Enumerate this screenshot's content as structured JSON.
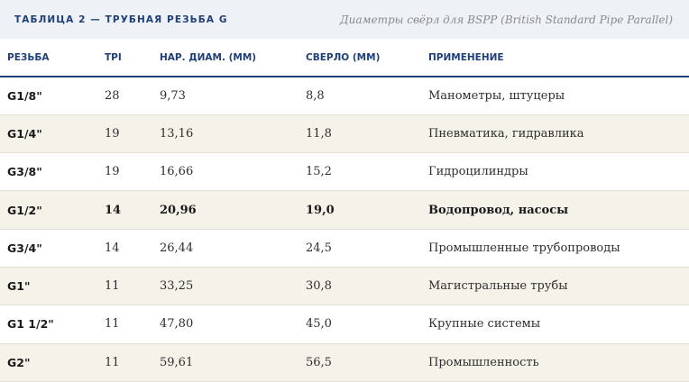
{
  "caption": {
    "title": "ТАБЛИЦА 2 — ТРУБНАЯ РЕЗЬБА G",
    "note": "Диаметры свёрл для BSPP (British Standard Pipe Parallel)"
  },
  "columns": [
    "РЕЗЬБА",
    "TPI",
    "НАР. ДИАМ. (ММ)",
    "СВЕРЛО (ММ)",
    "ПРИМЕНЕНИЕ"
  ],
  "rows": [
    {
      "thread": "G1/8\"",
      "tpi": "28",
      "od": "9,73",
      "drill": "8,8",
      "use": "Манометры, штуцеры"
    },
    {
      "thread": "G1/4\"",
      "tpi": "19",
      "od": "13,16",
      "drill": "11,8",
      "use": "Пневматика, гидравлика"
    },
    {
      "thread": "G3/8\"",
      "tpi": "19",
      "od": "16,66",
      "drill": "15,2",
      "use": "Гидроцилиндры"
    },
    {
      "thread": "G1/2\"",
      "tpi": "14",
      "od": "20,96",
      "drill": "19,0",
      "use": "Водопровод, насосы",
      "highlight": true
    },
    {
      "thread": "G3/4\"",
      "tpi": "14",
      "od": "26,44",
      "drill": "24,5",
      "use": "Промышленные трубопроводы"
    },
    {
      "thread": "G1\"",
      "tpi": "11",
      "od": "33,25",
      "drill": "30,8",
      "use": "Магистральные трубы"
    },
    {
      "thread": "G1 1/2\"",
      "tpi": "11",
      "od": "47,80",
      "drill": "45,0",
      "use": "Крупные системы"
    },
    {
      "thread": "G2\"",
      "tpi": "11",
      "od": "59,61",
      "drill": "56,5",
      "use": "Промышленность"
    }
  ]
}
